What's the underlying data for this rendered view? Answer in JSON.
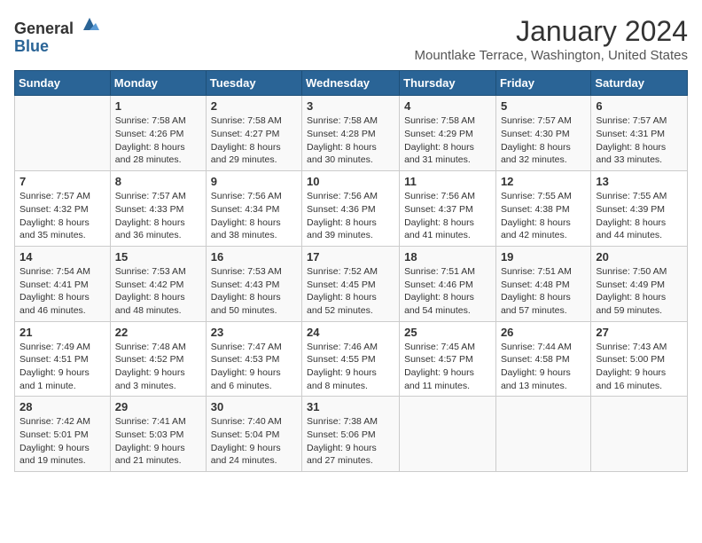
{
  "header": {
    "logo_general": "General",
    "logo_blue": "Blue",
    "title": "January 2024",
    "subtitle": "Mountlake Terrace, Washington, United States"
  },
  "days_of_week": [
    "Sunday",
    "Monday",
    "Tuesday",
    "Wednesday",
    "Thursday",
    "Friday",
    "Saturday"
  ],
  "weeks": [
    [
      {
        "day": "",
        "content": ""
      },
      {
        "day": "1",
        "content": "Sunrise: 7:58 AM\nSunset: 4:26 PM\nDaylight: 8 hours\nand 28 minutes."
      },
      {
        "day": "2",
        "content": "Sunrise: 7:58 AM\nSunset: 4:27 PM\nDaylight: 8 hours\nand 29 minutes."
      },
      {
        "day": "3",
        "content": "Sunrise: 7:58 AM\nSunset: 4:28 PM\nDaylight: 8 hours\nand 30 minutes."
      },
      {
        "day": "4",
        "content": "Sunrise: 7:58 AM\nSunset: 4:29 PM\nDaylight: 8 hours\nand 31 minutes."
      },
      {
        "day": "5",
        "content": "Sunrise: 7:57 AM\nSunset: 4:30 PM\nDaylight: 8 hours\nand 32 minutes."
      },
      {
        "day": "6",
        "content": "Sunrise: 7:57 AM\nSunset: 4:31 PM\nDaylight: 8 hours\nand 33 minutes."
      }
    ],
    [
      {
        "day": "7",
        "content": "Sunrise: 7:57 AM\nSunset: 4:32 PM\nDaylight: 8 hours\nand 35 minutes."
      },
      {
        "day": "8",
        "content": "Sunrise: 7:57 AM\nSunset: 4:33 PM\nDaylight: 8 hours\nand 36 minutes."
      },
      {
        "day": "9",
        "content": "Sunrise: 7:56 AM\nSunset: 4:34 PM\nDaylight: 8 hours\nand 38 minutes."
      },
      {
        "day": "10",
        "content": "Sunrise: 7:56 AM\nSunset: 4:36 PM\nDaylight: 8 hours\nand 39 minutes."
      },
      {
        "day": "11",
        "content": "Sunrise: 7:56 AM\nSunset: 4:37 PM\nDaylight: 8 hours\nand 41 minutes."
      },
      {
        "day": "12",
        "content": "Sunrise: 7:55 AM\nSunset: 4:38 PM\nDaylight: 8 hours\nand 42 minutes."
      },
      {
        "day": "13",
        "content": "Sunrise: 7:55 AM\nSunset: 4:39 PM\nDaylight: 8 hours\nand 44 minutes."
      }
    ],
    [
      {
        "day": "14",
        "content": "Sunrise: 7:54 AM\nSunset: 4:41 PM\nDaylight: 8 hours\nand 46 minutes."
      },
      {
        "day": "15",
        "content": "Sunrise: 7:53 AM\nSunset: 4:42 PM\nDaylight: 8 hours\nand 48 minutes."
      },
      {
        "day": "16",
        "content": "Sunrise: 7:53 AM\nSunset: 4:43 PM\nDaylight: 8 hours\nand 50 minutes."
      },
      {
        "day": "17",
        "content": "Sunrise: 7:52 AM\nSunset: 4:45 PM\nDaylight: 8 hours\nand 52 minutes."
      },
      {
        "day": "18",
        "content": "Sunrise: 7:51 AM\nSunset: 4:46 PM\nDaylight: 8 hours\nand 54 minutes."
      },
      {
        "day": "19",
        "content": "Sunrise: 7:51 AM\nSunset: 4:48 PM\nDaylight: 8 hours\nand 57 minutes."
      },
      {
        "day": "20",
        "content": "Sunrise: 7:50 AM\nSunset: 4:49 PM\nDaylight: 8 hours\nand 59 minutes."
      }
    ],
    [
      {
        "day": "21",
        "content": "Sunrise: 7:49 AM\nSunset: 4:51 PM\nDaylight: 9 hours\nand 1 minute."
      },
      {
        "day": "22",
        "content": "Sunrise: 7:48 AM\nSunset: 4:52 PM\nDaylight: 9 hours\nand 3 minutes."
      },
      {
        "day": "23",
        "content": "Sunrise: 7:47 AM\nSunset: 4:53 PM\nDaylight: 9 hours\nand 6 minutes."
      },
      {
        "day": "24",
        "content": "Sunrise: 7:46 AM\nSunset: 4:55 PM\nDaylight: 9 hours\nand 8 minutes."
      },
      {
        "day": "25",
        "content": "Sunrise: 7:45 AM\nSunset: 4:57 PM\nDaylight: 9 hours\nand 11 minutes."
      },
      {
        "day": "26",
        "content": "Sunrise: 7:44 AM\nSunset: 4:58 PM\nDaylight: 9 hours\nand 13 minutes."
      },
      {
        "day": "27",
        "content": "Sunrise: 7:43 AM\nSunset: 5:00 PM\nDaylight: 9 hours\nand 16 minutes."
      }
    ],
    [
      {
        "day": "28",
        "content": "Sunrise: 7:42 AM\nSunset: 5:01 PM\nDaylight: 9 hours\nand 19 minutes."
      },
      {
        "day": "29",
        "content": "Sunrise: 7:41 AM\nSunset: 5:03 PM\nDaylight: 9 hours\nand 21 minutes."
      },
      {
        "day": "30",
        "content": "Sunrise: 7:40 AM\nSunset: 5:04 PM\nDaylight: 9 hours\nand 24 minutes."
      },
      {
        "day": "31",
        "content": "Sunrise: 7:38 AM\nSunset: 5:06 PM\nDaylight: 9 hours\nand 27 minutes."
      },
      {
        "day": "",
        "content": ""
      },
      {
        "day": "",
        "content": ""
      },
      {
        "day": "",
        "content": ""
      }
    ]
  ]
}
